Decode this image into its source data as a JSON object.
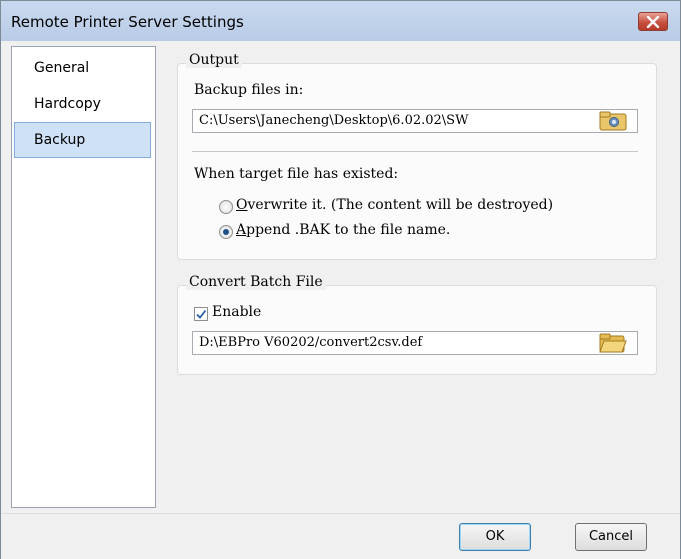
{
  "window": {
    "title": "Remote Printer Server Settings"
  },
  "nav": {
    "items": [
      {
        "label": "General",
        "selected": false
      },
      {
        "label": "Hardcopy",
        "selected": false
      },
      {
        "label": "Backup",
        "selected": true
      }
    ]
  },
  "output": {
    "group_title": "Output",
    "backup_label": "Backup files in:",
    "backup_path": "C:\\Users\\Janecheng\\Desktop\\6.02.02\\SW",
    "exists_label": "When target file has existed:",
    "overwrite_label": "Overwrite it. (The content will be destroyed)",
    "overwrite_mnemonic": "O",
    "overwrite_rest": "verwrite it. (The content will be destroyed)",
    "append_label": "Append .BAK to the file name.",
    "append_mnemonic": "A",
    "append_rest": "ppend .BAK to the file name.",
    "selected_option": "append"
  },
  "convert": {
    "group_title": "Convert Batch File",
    "enable_label": "Enable",
    "enabled": true,
    "file_path": "D:\\EBPro V60202/convert2csv.def"
  },
  "footer": {
    "ok_label": "OK",
    "cancel_label": "Cancel"
  },
  "icons": {
    "close": "close-icon",
    "folder": "folder-icon",
    "check": "checkmark-icon"
  },
  "colors": {
    "titlebar": "#c9d9ef",
    "close_button": "#c7503f",
    "nav_selected": "#cfe1f6",
    "radio_checked": "#1e4f8c"
  }
}
